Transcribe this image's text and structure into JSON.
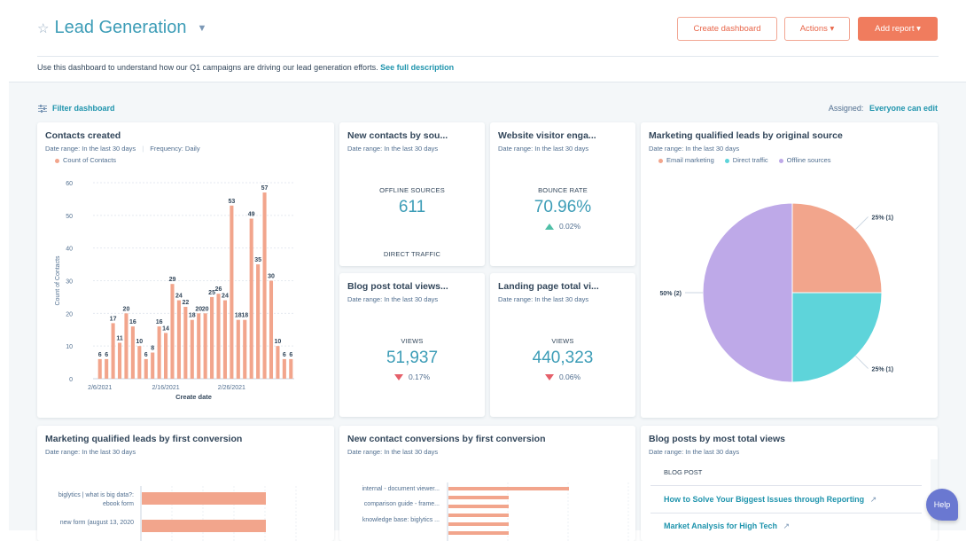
{
  "header": {
    "title": "Lead Generation",
    "star_icon": "star-outline-icon",
    "description": "Use this dashboard to understand how our Q1 campaigns are driving our lead generation efforts.",
    "description_link": "See full description",
    "buttons": {
      "create_dashboard": "Create dashboard",
      "actions": "Actions ▾",
      "add_report": "Add report ▾"
    }
  },
  "toolbar": {
    "filter_label": "Filter dashboard",
    "assigned_label": "Assigned:",
    "assigned_value": "Everyone can edit"
  },
  "colors": {
    "accent": "#3d9db7",
    "orange": "#f2a58c",
    "teal": "#5ed4da",
    "purple": "#bea9e8",
    "primary_button": "#f07c5e"
  },
  "cards": {
    "contacts_created": {
      "title": "Contacts created",
      "date_range": "Date range: In the last 30 days",
      "frequency": "Frequency: Daily",
      "legend": "Count of Contacts"
    },
    "new_contacts_by_source": {
      "title": "New contacts by sou...",
      "date_range": "Date range: In the last 30 days",
      "label": "OFFLINE SOURCES",
      "value": "611",
      "label2": "DIRECT TRAFFIC"
    },
    "website_visitor": {
      "title": "Website visitor enga...",
      "date_range": "Date range: In the last 30 days",
      "label": "BOUNCE RATE",
      "value": "70.96%",
      "delta": "0.02%",
      "delta_direction": "up"
    },
    "blog_post_views": {
      "title": "Blog post total views...",
      "date_range": "Date range: In the last 30 days",
      "label": "VIEWS",
      "value": "51,937",
      "delta": "0.17%",
      "delta_direction": "down"
    },
    "landing_page_views": {
      "title": "Landing page total vi...",
      "date_range": "Date range: In the last 30 days",
      "label": "VIEWS",
      "value": "440,323",
      "delta": "0.06%",
      "delta_direction": "down"
    },
    "mql_by_source": {
      "title": "Marketing qualified leads by original source",
      "date_range": "Date range: In the last 30 days"
    },
    "mql_by_first_conversion": {
      "title": "Marketing qualified leads by first conversion",
      "date_range": "Date range: In the last 30 days",
      "rows": [
        {
          "label_line1": "biglytics | what is big data?:",
          "label_line2": "ebook form",
          "value": 1
        },
        {
          "label_line1": "new form (august 13, 2020",
          "label_line2": "",
          "value": 1
        }
      ]
    },
    "new_contact_conversions": {
      "title": "New contact conversions by first conversion",
      "date_range": "Date range: In the last 30 days",
      "labels": [
        "internal - document viewer...",
        "comparison guide - frame...",
        "knowledge base: biglytics ..."
      ],
      "bars": [
        2,
        1,
        1,
        1,
        1,
        1
      ]
    },
    "blog_posts": {
      "title": "Blog posts by most total views",
      "date_range": "Date range: In the last 30 days",
      "column": "BLOG POST",
      "rows": [
        "How to Solve Your Biggest Issues through Reporting",
        "Market Analysis for High Tech"
      ]
    }
  },
  "help_label": "Help",
  "chart_data": [
    {
      "type": "bar",
      "title": "Contacts created",
      "xlabel": "Create date",
      "ylabel": "Count of Contacts",
      "ylim": [
        0,
        60
      ],
      "yticks": [
        0,
        10,
        20,
        30,
        40,
        50,
        60
      ],
      "xtick_labels": [
        "2/6/2021",
        "2/16/2021",
        "2/26/2021"
      ],
      "grid": true,
      "legend": "top-left",
      "series": [
        {
          "name": "Count of Contacts",
          "values": [
            6,
            6,
            17,
            11,
            20,
            16,
            10,
            6,
            8,
            16,
            14,
            29,
            24,
            22,
            18,
            20,
            20,
            25,
            26,
            24,
            53,
            18,
            18,
            49,
            35,
            57,
            30,
            10,
            6,
            6
          ]
        }
      ]
    },
    {
      "type": "pie",
      "title": "Marketing qualified leads by original source",
      "legend": "top",
      "categories": [
        "Email marketing",
        "Direct traffic",
        "Offline sources"
      ],
      "values": [
        1,
        1,
        2
      ],
      "labels": [
        "25% (1)",
        "25% (1)",
        "50% (2)"
      ]
    }
  ]
}
